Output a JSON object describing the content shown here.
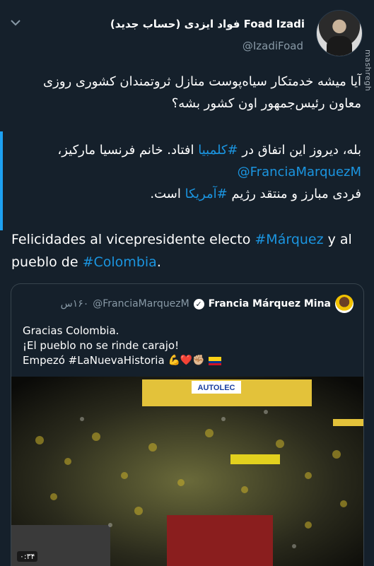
{
  "tweet": {
    "author_name": "Foad Izadi",
    "author_name_fa": "فواد ایزدی",
    "author_note": "(حساب جدید)",
    "handle": "@IzadiFoad",
    "text_fa_1": "آیا میشه خدمتکار سیاه‌پوست منازل ثروتمندان کشوری روزی معاون رئیس‌جمهور اون کشور بشه؟",
    "text_fa_2_before": "بله، دیروز این اتفاق در ",
    "hashtag_colombia_fa": "#کلمبیا",
    "text_fa_2_after": " افتاد. خانم فرنسیا مارکیز،",
    "mention": "@FranciaMarquezM",
    "text_fa_3_before": "فردی مبارز و منتقد رژیم ",
    "hashtag_america_fa": "#آمریکا",
    "text_fa_3_after": " است.",
    "text_es_before": "Felicidades al vicepresidente electo ",
    "hashtag_marquez": "#Márquez",
    "text_es_middle": " y al pueblo de ",
    "hashtag_colombia": "#Colombia",
    "text_es_after": "."
  },
  "watermark": "mashregh",
  "quoted": {
    "name": "Francia Márquez Mina",
    "handle": "@FranciaMarquezM",
    "time": "۱۶۰س",
    "line1": "Gracias Colombia.",
    "line2": "¡El pueblo no se rinde carajo!",
    "line3": "Empezó #LaNuevaHistoria",
    "emojis": "💪❤️✊🏼",
    "media_sign": "AUTOLEC",
    "video_duration": "۰:۳۴"
  },
  "icons": {
    "chevron": "chevron-down-icon",
    "verified": "verified-badge-icon"
  },
  "colors": {
    "background": "#15202b",
    "link": "#1b95e0",
    "muted": "#8899a6",
    "accent_bar": "#1da1f2"
  }
}
